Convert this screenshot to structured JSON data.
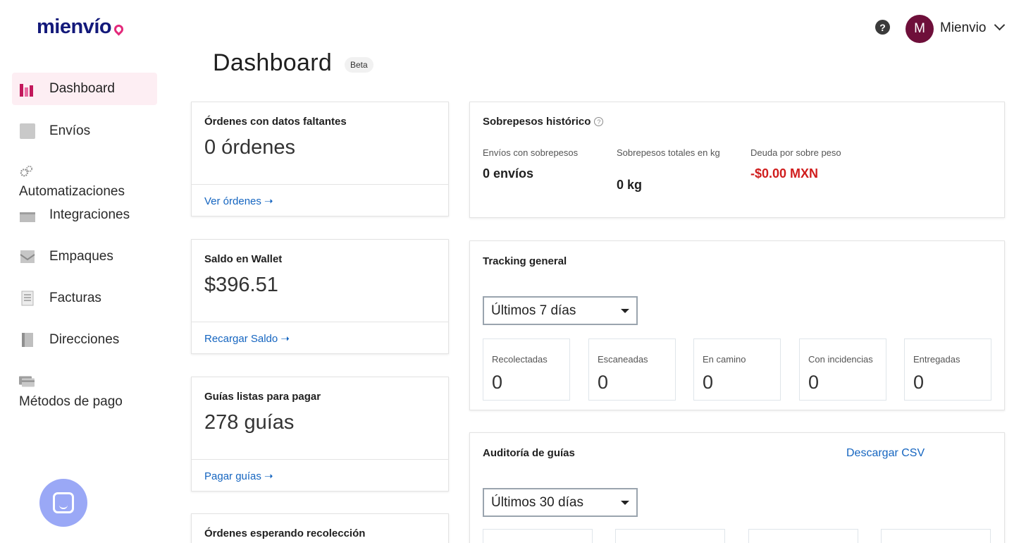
{
  "brand": {
    "name": "mienvío",
    "accent": "#e3287a",
    "color": "#13197a"
  },
  "header": {
    "help_icon": "?",
    "avatar_initial": "M",
    "user_name": "Mienvio"
  },
  "sidebar": {
    "items": [
      {
        "label": "Dashboard",
        "icon": "bar-chart-icon",
        "active": true
      },
      {
        "label": "Envíos",
        "icon": "package-icon"
      },
      {
        "label": "Automatizaciones",
        "icon": "gears-icon"
      },
      {
        "label": "Integraciones",
        "icon": "plug-icon"
      },
      {
        "label": "Empaques",
        "icon": "box-icon"
      },
      {
        "label": "Facturas",
        "icon": "invoice-icon"
      },
      {
        "label": "Direcciones",
        "icon": "address-book-icon"
      },
      {
        "label": "Métodos de pago",
        "icon": "credit-card-icon"
      }
    ]
  },
  "page": {
    "title": "Dashboard",
    "badge": "Beta"
  },
  "cards": {
    "missing_data": {
      "title": "Órdenes con datos faltantes",
      "value": "0 órdenes",
      "link": "Ver órdenes ➝"
    },
    "wallet": {
      "title": "Saldo en Wallet",
      "value": "$396.51",
      "link": "Recargar Saldo ➝"
    },
    "labels": {
      "title": "Guías listas para pagar",
      "value": "278 guías",
      "link": "Pagar guías ➝"
    },
    "pickup": {
      "title": "Órdenes esperando recolección"
    }
  },
  "overweight": {
    "title": "Sobrepesos histórico",
    "info_icon": "?",
    "metrics": [
      {
        "label": "Envíos con sobrepesos",
        "value": "0 envíos"
      },
      {
        "label": "Sobrepesos totales en kg",
        "value": "0 kg"
      },
      {
        "label": "Deuda por sobre peso",
        "value": "-$0.00 MXN",
        "color": "#d01d1d"
      }
    ]
  },
  "tracking": {
    "title": "Tracking general",
    "select_value": "Últimos 7 días",
    "stats": [
      {
        "label": "Recolectadas",
        "value": "0"
      },
      {
        "label": "Escaneadas",
        "value": "0"
      },
      {
        "label": "En camino",
        "value": "0"
      },
      {
        "label": "Con incidencias",
        "value": "0"
      },
      {
        "label": "Entregadas",
        "value": "0"
      }
    ]
  },
  "audit": {
    "title": "Auditoría de guías",
    "download_label": "Descargar CSV",
    "select_value": "Últimos 30 días"
  }
}
